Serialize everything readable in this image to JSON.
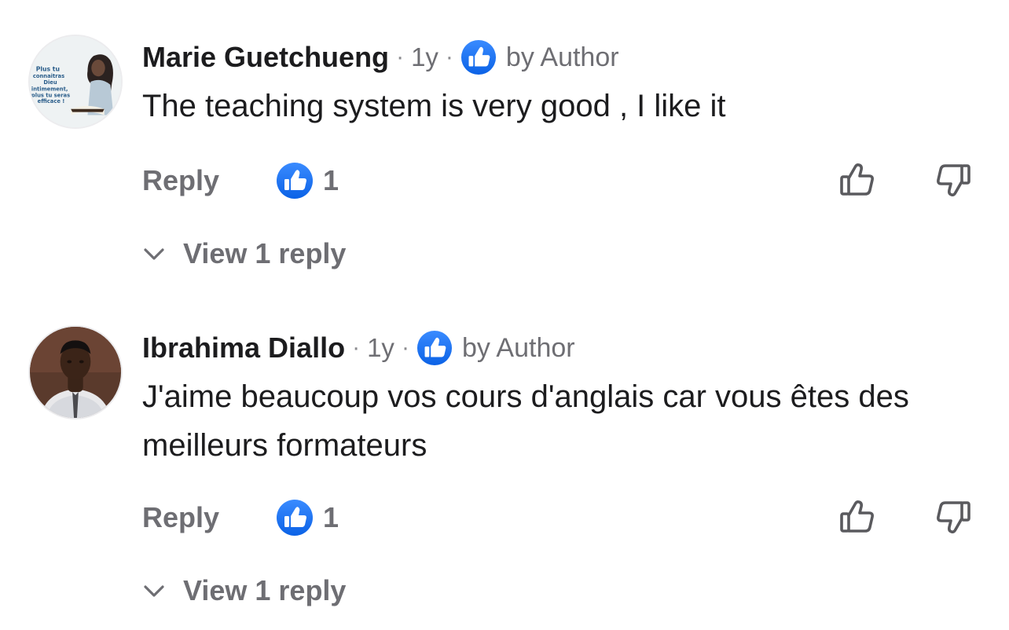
{
  "comments": [
    {
      "author": "Marie Guetchueng",
      "separator": "·",
      "time": "1y",
      "badge_icon": "thumbs-up-badge-icon",
      "badge_label": "by Author",
      "text": "The teaching system is very good , I like it",
      "avatar_caption": [
        "Plus tu",
        "connaitras",
        "Dieu",
        "intimement,",
        "plus tu seras",
        "efficace !"
      ],
      "reply_label": "Reply",
      "like_count": "1",
      "view_replies_label": "View 1 reply"
    },
    {
      "author": "Ibrahima Diallo",
      "separator": "·",
      "time": "1y",
      "badge_icon": "thumbs-up-badge-icon",
      "badge_label": "by Author",
      "text": "J'aime beaucoup vos cours d'anglais car vous êtes des meilleurs formateurs",
      "reply_label": "Reply",
      "like_count": "1",
      "view_replies_label": "View 1 reply"
    }
  ],
  "colors": {
    "badge_blue": "#1877f2",
    "text_primary": "#1c1c1e",
    "text_secondary": "#6e6e73"
  }
}
